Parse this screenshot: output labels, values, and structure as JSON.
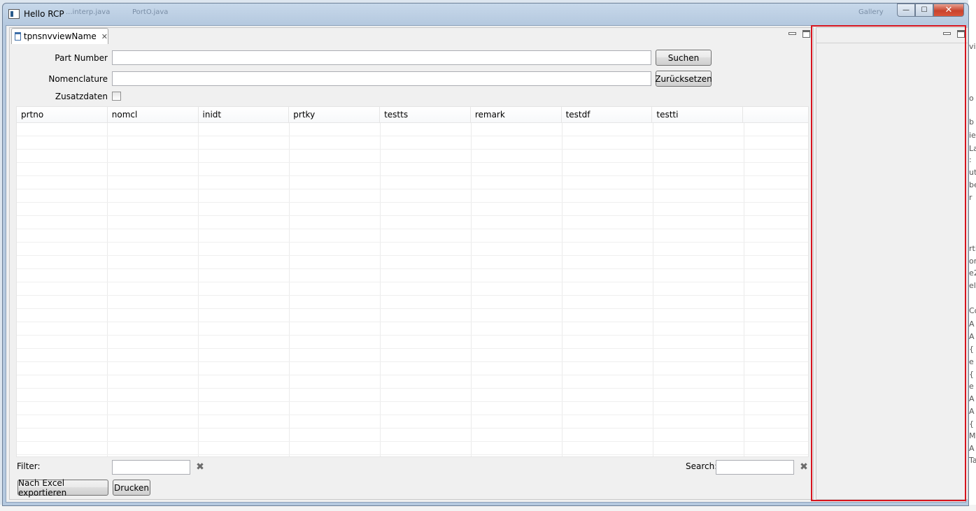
{
  "window": {
    "title": "Hello RCP",
    "ghost_tabs": [
      "...interp.java",
      "PortO.java",
      "Gallery"
    ]
  },
  "background": {
    "right_fragments": [
      "vi",
      "o",
      "b",
      "ie",
      "La",
      ": ",
      "ut",
      "be",
      "r",
      "rti",
      "on",
      "e2",
      "el",
      "Co",
      "A",
      "A",
      "{",
      "e",
      "{",
      "e",
      "A",
      "A",
      "{",
      "Me",
      "A",
      "Ta"
    ]
  },
  "view": {
    "tab_label": "tpnsnvviewName"
  },
  "form": {
    "part_number_label": "Part Number",
    "part_number_value": "",
    "nomenclature_label": "Nomenclature",
    "nomenclature_value": "",
    "zusatzdaten_label": "Zusatzdaten",
    "search_button": "Suchen",
    "reset_button": "Zurücksetzen"
  },
  "table": {
    "columns": [
      "prtno",
      "nomcl",
      "inidt",
      "prtky",
      "testts",
      "remark",
      "testdf",
      "testti"
    ]
  },
  "footer": {
    "filter_label": "Filter:",
    "filter_value": "",
    "search_label": "Search:",
    "search_value": "",
    "export_button": "Nach Excel exportieren",
    "print_button": "Drucken"
  },
  "window_controls": {
    "minimize": "—",
    "maximize": "☐",
    "close": "✕"
  },
  "colors": {
    "highlight": "#d7141e"
  }
}
